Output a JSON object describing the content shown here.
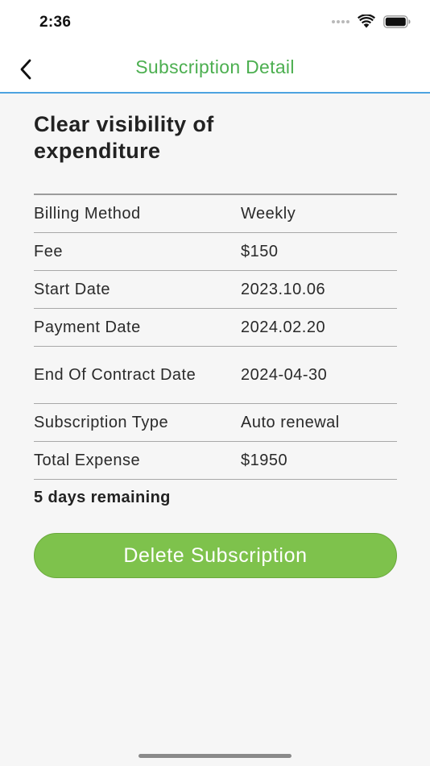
{
  "status_bar": {
    "time": "2:36"
  },
  "nav": {
    "title": "Subscription Detail",
    "accent_color": "#4caf50",
    "divider_color": "#4da3e0"
  },
  "content": {
    "headline_line1": "Clear visibility of",
    "headline_line2": "expenditure",
    "rows": [
      {
        "label": "Billing Method",
        "value": "Weekly"
      },
      {
        "label": "Fee",
        "value": "$150"
      },
      {
        "label": "Start Date",
        "value": "2023.10.06"
      },
      {
        "label": "Payment Date",
        "value": "2024.02.20"
      },
      {
        "label": "End Of Contract Date",
        "value": "2024-04-30"
      },
      {
        "label": "Subscription Type",
        "value": "Auto renewal"
      },
      {
        "label": "Total Expense",
        "value": "$1950"
      }
    ],
    "remaining": "5 days remaining",
    "delete_label": "Delete Subscription",
    "delete_color": "#7ec24c"
  },
  "icons": {
    "back": "chevron-left-icon",
    "wifi": "wifi-icon",
    "battery": "battery-icon",
    "cellular": "cellular-signal-icon"
  }
}
